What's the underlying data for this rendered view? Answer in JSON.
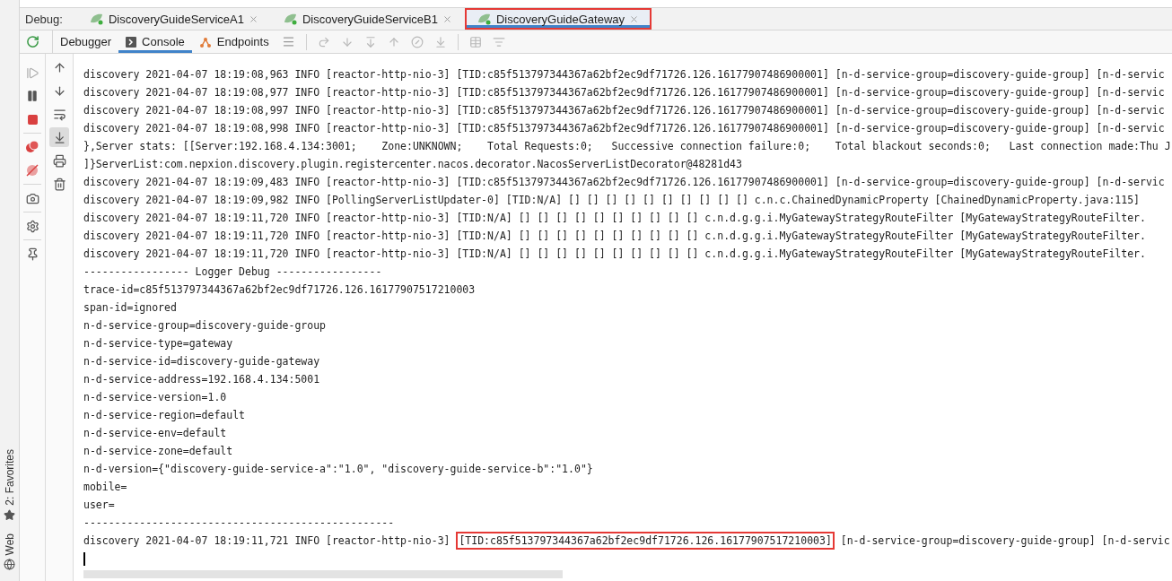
{
  "debug_label": "Debug:",
  "sessions": [
    {
      "label": "DiscoveryGuideServiceA1",
      "selected": false,
      "highlighted": false
    },
    {
      "label": "DiscoveryGuideServiceB1",
      "selected": false,
      "highlighted": false
    },
    {
      "label": "DiscoveryGuideGateway",
      "selected": true,
      "highlighted": true
    }
  ],
  "tool_tabs": [
    {
      "label": "Debugger",
      "selected": false,
      "kind": "plain"
    },
    {
      "label": "Console",
      "selected": true,
      "kind": "console"
    },
    {
      "label": "Endpoints",
      "selected": false,
      "kind": "endpoints"
    }
  ],
  "console_actions": [
    {
      "kind": "up",
      "selected": false
    },
    {
      "kind": "down",
      "selected": false
    },
    {
      "kind": "wrap",
      "selected": false
    },
    {
      "kind": "scroll-end",
      "selected": true
    },
    {
      "kind": "print",
      "selected": false
    },
    {
      "kind": "trash",
      "selected": false
    }
  ],
  "tool_windows": [
    {
      "label": "2: Favorites",
      "kind": "star"
    },
    {
      "label": "Web",
      "kind": "globe"
    }
  ],
  "console": {
    "cursor": true,
    "lines": [
      {
        "text": "discovery 2021-04-07 18:19:08,963 INFO [reactor-http-nio-3] [TID:c85f513797344367a62bf2ec9df71726.126.16177907486900001] [n-d-service-group=discovery-guide-group] [n-d-servic"
      },
      {
        "text": "discovery 2021-04-07 18:19:08,977 INFO [reactor-http-nio-3] [TID:c85f513797344367a62bf2ec9df71726.126.16177907486900001] [n-d-service-group=discovery-guide-group] [n-d-servic"
      },
      {
        "text": "discovery 2021-04-07 18:19:08,997 INFO [reactor-http-nio-3] [TID:c85f513797344367a62bf2ec9df71726.126.16177907486900001] [n-d-service-group=discovery-guide-group] [n-d-servic"
      },
      {
        "text": "discovery 2021-04-07 18:19:08,998 INFO [reactor-http-nio-3] [TID:c85f513797344367a62bf2ec9df71726.126.16177907486900001] [n-d-service-group=discovery-guide-group] [n-d-servic"
      },
      {
        "text": "},Server stats: [[Server:192.168.4.134:3001;    Zone:UNKNOWN;    Total Requests:0;   Successive connection failure:0;    Total blackout seconds:0;   Last connection made:Thu J"
      },
      {
        "text": "]}ServerList:com.nepxion.discovery.plugin.registercenter.nacos.decorator.NacosServerListDecorator@48281d43"
      },
      {
        "text": "discovery 2021-04-07 18:19:09,483 INFO [reactor-http-nio-3] [TID:c85f513797344367a62bf2ec9df71726.126.16177907486900001] [n-d-service-group=discovery-guide-group] [n-d-servic"
      },
      {
        "text": "discovery 2021-04-07 18:19:09,982 INFO [PollingServerListUpdater-0] [TID:N/A] [] [] [] [] [] [] [] [] [] [] c.n.c.ChainedDynamicProperty [ChainedDynamicProperty.java:115]"
      },
      {
        "text": "discovery 2021-04-07 18:19:11,720 INFO [reactor-http-nio-3] [TID:N/A] [] [] [] [] [] [] [] [] [] [] c.n.d.g.g.i.MyGatewayStrategyRouteFilter [MyGatewayStrategyRouteFilter."
      },
      {
        "text": "discovery 2021-04-07 18:19:11,720 INFO [reactor-http-nio-3] [TID:N/A] [] [] [] [] [] [] [] [] [] [] c.n.d.g.g.i.MyGatewayStrategyRouteFilter [MyGatewayStrategyRouteFilter."
      },
      {
        "text": "discovery 2021-04-07 18:19:11,720 INFO [reactor-http-nio-3] [TID:N/A] [] [] [] [] [] [] [] [] [] [] c.n.d.g.g.i.MyGatewayStrategyRouteFilter [MyGatewayStrategyRouteFilter."
      },
      {
        "text": "----------------- Logger Debug -----------------"
      },
      {
        "text": "trace-id=c85f513797344367a62bf2ec9df71726.126.16177907517210003"
      },
      {
        "text": "span-id=ignored"
      },
      {
        "text": "n-d-service-group=discovery-guide-group"
      },
      {
        "text": "n-d-service-type=gateway"
      },
      {
        "text": "n-d-service-id=discovery-guide-gateway"
      },
      {
        "text": "n-d-service-address=192.168.4.134:5001"
      },
      {
        "text": "n-d-service-version=1.0"
      },
      {
        "text": "n-d-service-region=default"
      },
      {
        "text": "n-d-service-env=default"
      },
      {
        "text": "n-d-service-zone=default"
      },
      {
        "text": "n-d-version={\"discovery-guide-service-a\":\"1.0\", \"discovery-guide-service-b\":\"1.0\"}"
      },
      {
        "text": "mobile="
      },
      {
        "text": "user="
      },
      {
        "text": "--------------------------------------------------"
      },
      {
        "text": "discovery 2021-04-07 18:19:11,721 INFO [reactor-http-nio-3] ",
        "highlight": "[TID:c85f513797344367a62bf2ec9df71726.126.16177907517210003]",
        "rest": " [n-d-service-group=discovery-guide-group] [n-d-servic"
      }
    ]
  }
}
